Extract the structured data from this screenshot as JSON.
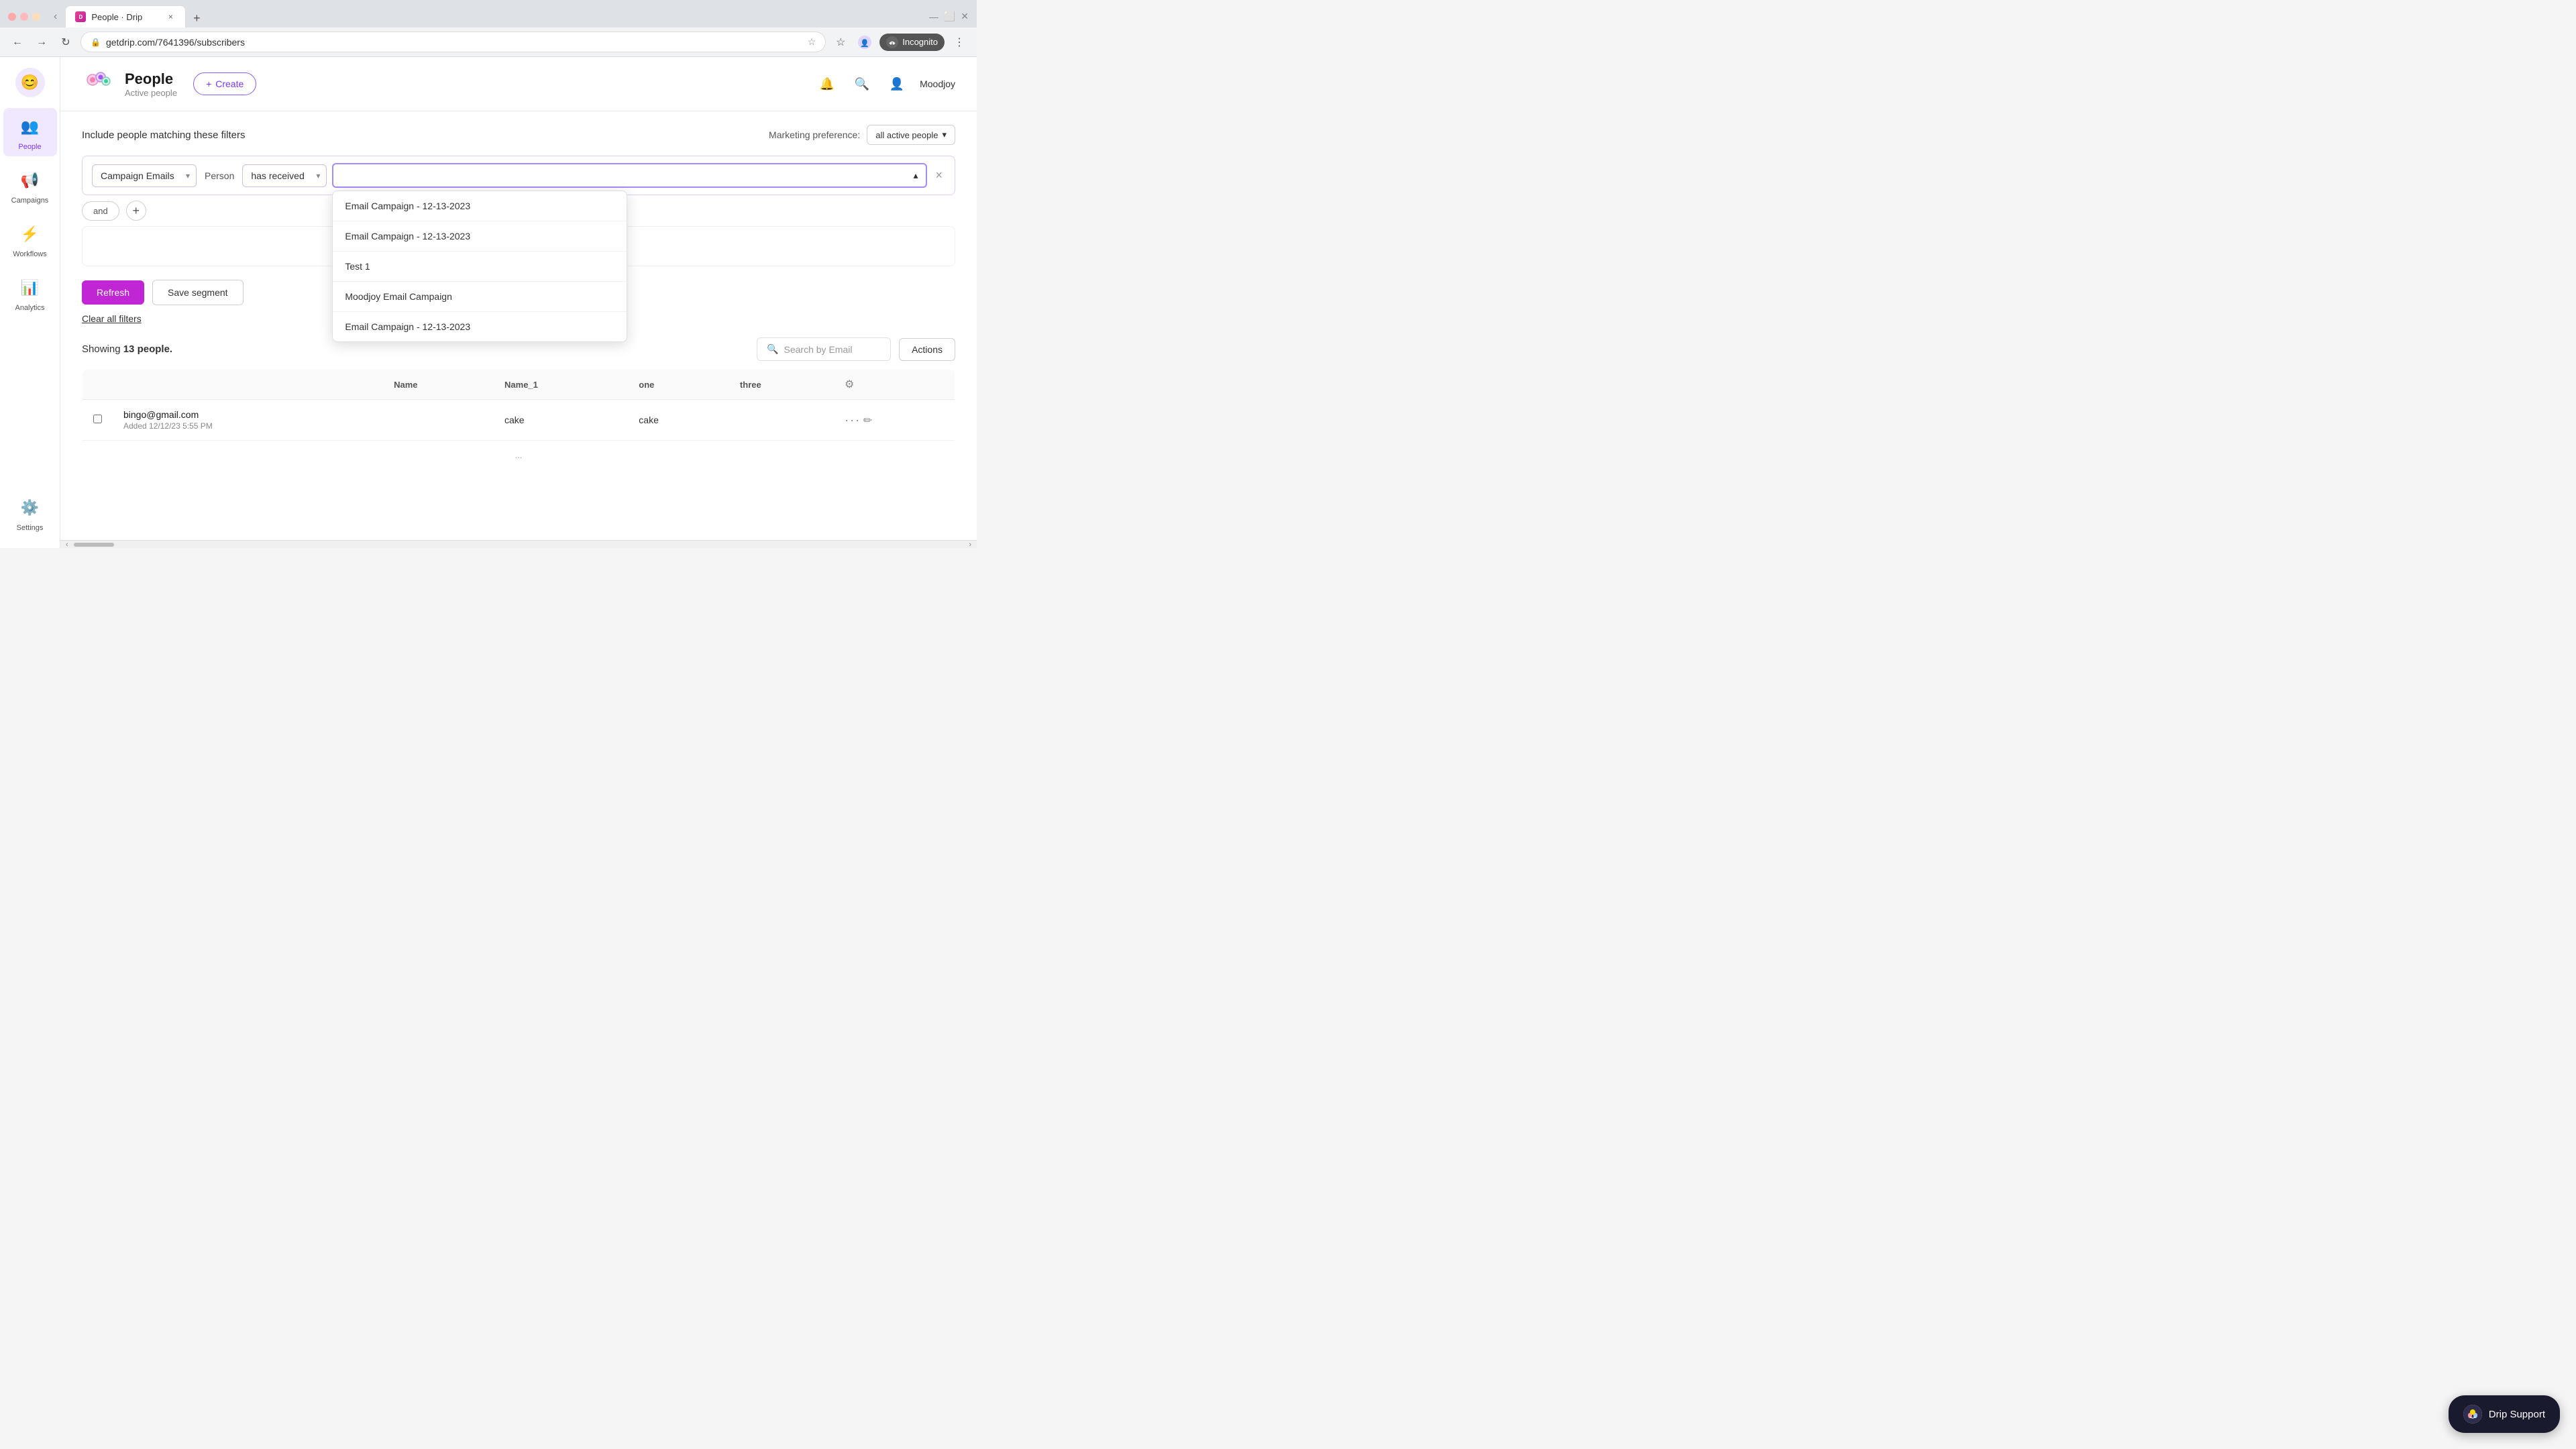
{
  "browser": {
    "tab_title": "People · Drip",
    "url": "getdrip.com/7641396/subscribers",
    "incognito_label": "Incognito"
  },
  "sidebar": {
    "logo_emoji": "😊",
    "items": [
      {
        "id": "people",
        "label": "People",
        "icon": "👥",
        "active": true
      },
      {
        "id": "campaigns",
        "label": "Campaigns",
        "icon": "📢",
        "active": false
      },
      {
        "id": "workflows",
        "label": "Workflows",
        "icon": "⚡",
        "active": false
      },
      {
        "id": "analytics",
        "label": "Analytics",
        "icon": "📊",
        "active": false
      }
    ],
    "bottom_items": [
      {
        "id": "settings",
        "label": "Settings",
        "icon": "⚙️"
      }
    ]
  },
  "header": {
    "icon": "👥",
    "title": "People",
    "subtitle": "Active people",
    "create_label": "Create",
    "user_name": "Moodjoy"
  },
  "filters": {
    "title": "Include people matching these filters",
    "marketing_label": "Marketing preference:",
    "marketing_value": "all active people",
    "filter_type": "Campaign Emails",
    "filter_person": "Person",
    "filter_condition": "has received",
    "dropdown_placeholder": "",
    "campaign_options": [
      "Email Campaign - 12-13-2023",
      "Email Campaign - 12-13-2023",
      "Test 1",
      "Moodjoy Email Campaign",
      "Email Campaign - 12-13-2023"
    ],
    "and_label": "and",
    "refresh_label": "Refresh",
    "save_segment_label": "Save segment",
    "clear_filters_label": "Clear all filters"
  },
  "table": {
    "showing_prefix": "Showing",
    "showing_count": "13 people.",
    "search_placeholder": "Search by Email",
    "actions_label": "Actions",
    "columns": [
      {
        "key": "name",
        "label": "Name"
      },
      {
        "key": "name1",
        "label": "Name_1"
      },
      {
        "key": "one",
        "label": "one"
      },
      {
        "key": "three",
        "label": "three"
      }
    ],
    "rows": [
      {
        "email": "bingo@gmail.com",
        "added": "Added 12/12/23 5:55 PM",
        "name": "",
        "name1": "cake",
        "one": "cake",
        "three": ""
      }
    ]
  },
  "drip_support": {
    "label": "Drip Support"
  }
}
